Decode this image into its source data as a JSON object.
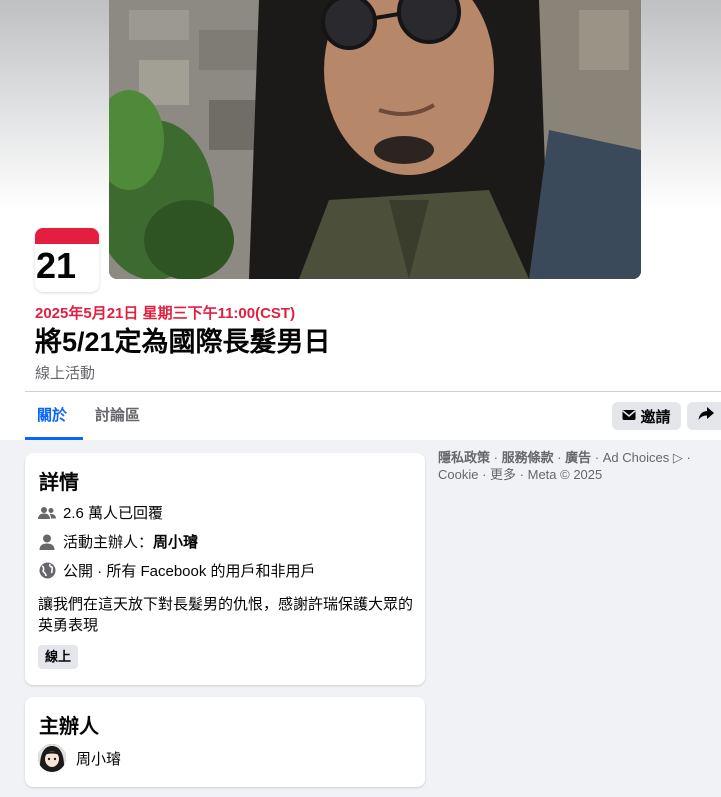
{
  "event": {
    "day": "21",
    "datetime": "2025年5月21日 星期三下午11:00(CST)",
    "title": "將5/21定為國際長髮男日",
    "type": "線上活動"
  },
  "tabs": [
    {
      "label": "關於",
      "active": true
    },
    {
      "label": "討論區",
      "active": false
    }
  ],
  "actions": {
    "invite_label": "邀請"
  },
  "details": {
    "title": "詳情",
    "responses": "2.6 萬人已回覆",
    "host_prefix": "活動主辦人：",
    "host_name": "周小璿",
    "privacy": "公開 · 所有 Facebook 的用戶和非用戶",
    "description": "讓我們在這天放下對長髮男的仇恨，感謝許瑞保護大眾的英勇表現",
    "tag": "線上"
  },
  "host_card": {
    "title": "主辦人",
    "name": "周小璿"
  },
  "footer": {
    "privacy": "隱私政策",
    "terms": "服務條款",
    "ads": "廣告",
    "ad_choices": "Ad Choices",
    "cookie": "Cookie",
    "more": "更多",
    "meta": "Meta © 2025"
  },
  "colors": {
    "accent": "#0866ff",
    "date_red": "#e41e3f",
    "secondary_text": "#65676b"
  }
}
